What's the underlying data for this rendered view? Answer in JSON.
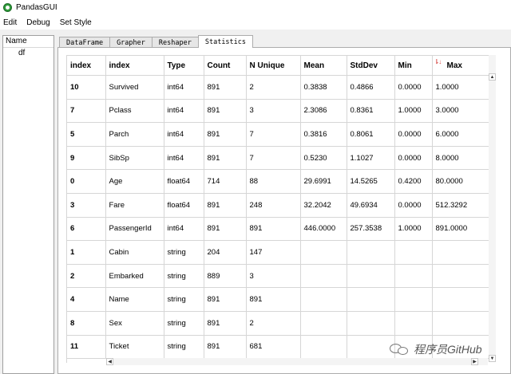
{
  "window": {
    "title": "PandasGUI"
  },
  "menu": [
    "Edit",
    "Debug",
    "Set Style"
  ],
  "sidebar": {
    "header": "Name",
    "items": [
      "df"
    ]
  },
  "tabs": [
    {
      "label": "DataFrame",
      "active": false
    },
    {
      "label": "Grapher",
      "active": false
    },
    {
      "label": "Reshaper",
      "active": false
    },
    {
      "label": "Statistics",
      "active": true
    }
  ],
  "table": {
    "columns": [
      "index",
      "index",
      "Type",
      "Count",
      "N Unique",
      "Mean",
      "StdDev",
      "Min",
      "Max"
    ],
    "sorted_column": "Max",
    "rows": [
      [
        "10",
        "Survived",
        "int64",
        "891",
        "2",
        "0.3838",
        "0.4866",
        "0.0000",
        "1.0000"
      ],
      [
        "7",
        "Pclass",
        "int64",
        "891",
        "3",
        "2.3086",
        "0.8361",
        "1.0000",
        "3.0000"
      ],
      [
        "5",
        "Parch",
        "int64",
        "891",
        "7",
        "0.3816",
        "0.8061",
        "0.0000",
        "6.0000"
      ],
      [
        "9",
        "SibSp",
        "int64",
        "891",
        "7",
        "0.5230",
        "1.1027",
        "0.0000",
        "8.0000"
      ],
      [
        "0",
        "Age",
        "float64",
        "714",
        "88",
        "29.6991",
        "14.5265",
        "0.4200",
        "80.0000"
      ],
      [
        "3",
        "Fare",
        "float64",
        "891",
        "248",
        "32.2042",
        "49.6934",
        "0.0000",
        "512.3292"
      ],
      [
        "6",
        "PassengerId",
        "int64",
        "891",
        "891",
        "446.0000",
        "257.3538",
        "1.0000",
        "891.0000"
      ],
      [
        "1",
        "Cabin",
        "string",
        "204",
        "147",
        "",
        "",
        "",
        ""
      ],
      [
        "2",
        "Embarked",
        "string",
        "889",
        "3",
        "",
        "",
        "",
        ""
      ],
      [
        "4",
        "Name",
        "string",
        "891",
        "891",
        "",
        "",
        "",
        ""
      ],
      [
        "8",
        "Sex",
        "string",
        "891",
        "2",
        "",
        "",
        "",
        ""
      ],
      [
        "11",
        "Ticket",
        "string",
        "891",
        "681",
        "",
        "",
        "",
        ""
      ]
    ]
  },
  "watermark": {
    "text": "程序员GitHub"
  },
  "colors": {
    "app_icon": "#2e9a3a",
    "sort_indicator": "#d9534f"
  }
}
